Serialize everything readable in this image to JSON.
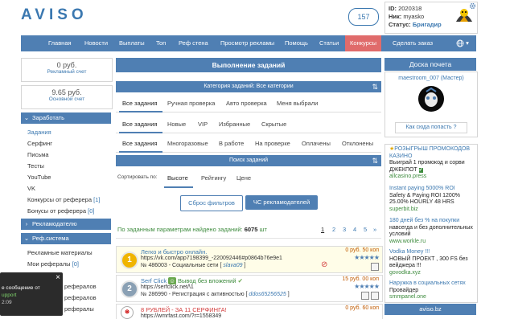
{
  "header": {
    "logo": "AVISO",
    "balance_badge": "157",
    "user": {
      "id_label": "ID:",
      "id_value": "2020318",
      "nick_label": "Ник:",
      "nick_value": "myasko",
      "status_label": "Статус:",
      "status_value": "Бригадир"
    }
  },
  "nav": {
    "items": [
      "Главная",
      "Новости",
      "Выплаты",
      "Топ",
      "Реф стена",
      "Просмотр рекламы",
      "Помощь",
      "Статьи",
      "Конкурсы",
      "Сделать заказ"
    ],
    "active": "Конкурсы"
  },
  "sidebar": {
    "ad_balance_value": "0 руб.",
    "ad_balance_label": "Рекламный счет",
    "main_balance_value": "9.65 руб.",
    "main_balance_label": "Основной счет",
    "earn_header": "Заработать",
    "earn_items": [
      "Задания",
      "Серфинг",
      "Письма",
      "Тесты",
      "YouTube",
      "VK"
    ],
    "earn_item_contests": "Конкурсы от реферера",
    "earn_item_contests_count": "[1]",
    "earn_item_bonuses": "Бонусы от реферера",
    "earn_item_bonuses_count": "[0]",
    "advertiser_header": "Рекламодателю",
    "ref_header": "Реф.система",
    "ref_items_materials": "Рекламные материалы",
    "ref_items_my": "Мои рефералы",
    "ref_items_my_count": "[0]",
    "ref_items_more1": "рефералов",
    "ref_items_more2": "рефералов",
    "ref_items_more3": "рефералы"
  },
  "main": {
    "title": "Выполнение заданий",
    "category_bar": "Категория заданий: Все категории",
    "tabs1": [
      "Все задания",
      "Ручная проверка",
      "Авто проверка",
      "Меня выбрали"
    ],
    "tabs2": [
      "Все задания",
      "Новые",
      "VIP",
      "Избранные",
      "Скрытые"
    ],
    "tabs3": [
      "Все задания",
      "Многоразовые",
      "В работе",
      "На проверке",
      "Оплачены",
      "Отклонены"
    ],
    "search_bar": "Поиск заданий",
    "sort_label": "Сортировать по:",
    "sort_options": [
      "Высоте",
      "Рейтингу",
      "Цене"
    ],
    "reset_button": "Сброс фильтров",
    "blacklist_button": "ЧС рекламодателей",
    "found_prefix": "По заданным параметрам найдено заданий:",
    "found_count": "6075",
    "found_suffix": "шт",
    "pages": [
      "1",
      "2",
      "3",
      "4",
      "5",
      "»"
    ],
    "tasks": [
      {
        "num": "1",
        "title": "Легко и быстро онлайн.",
        "url": "https://vk.com/app7198399_-220092446#p0864b76e9e1",
        "meta": "№ 486003 - Социальные сети",
        "author": "slava09",
        "price": "0 руб. 50 коп",
        "stars": "★★★★★"
      },
      {
        "num": "2",
        "title": "Serf Click",
        "title_extra": "Вывод без вложений",
        "url": "https://serfclick.net/\\1",
        "meta": "№ 286990 - Регистрация с активностью",
        "author": "ddos65256525",
        "price": "15 руб. 00 коп",
        "stars": "★★★★★"
      },
      {
        "num": "3",
        "title": "8 РУБЛЕЙ - ЗА 11 СЕРФИНГА!",
        "url": "https://wmrfast.com/?r=1558349",
        "price": "0 руб. 60 коп"
      }
    ]
  },
  "right": {
    "honor_header": "Доска почета",
    "honor_user": "maestroom_007 (Мастер)",
    "honor_link": "Как сюда попасть ?",
    "ads": [
      {
        "title": "РОЗЫГРЫШ ПРОМОКОДОВ КАЗИНО",
        "body": "Выиграй 1 промокод и сорви ДЖЕКПОТ",
        "site": "allcasino.press"
      },
      {
        "title": "Instant paying 5000% ROI",
        "body": "Safety & Paying ROI 1200% 25.00% HOURLY 48 HRS",
        "site": "superbit.biz"
      },
      {
        "title": "180 дней без % на покупки",
        "body": "навсегда и без дополнительных условий",
        "site": "www.workle.ru"
      },
      {
        "title": "Vodka Money !!!",
        "body": "НОВЫЙ ПРОЕКТ , 300 FS без вейджера !!!",
        "site": "govodka.xyz"
      },
      {
        "title": "Наружка в социальных сетях",
        "body": "Провайдер",
        "site": "smmpanel.one"
      }
    ],
    "footer": "aviso.bz"
  },
  "toast": {
    "line1": "е сообщение от",
    "line2": "upport",
    "line3": "2:09",
    "close": "×"
  },
  "colors": {
    "brand_blue": "#4f7fb3",
    "link_blue": "#3b78b0",
    "active_red": "#e06b6b",
    "green": "#3d8b3d"
  }
}
